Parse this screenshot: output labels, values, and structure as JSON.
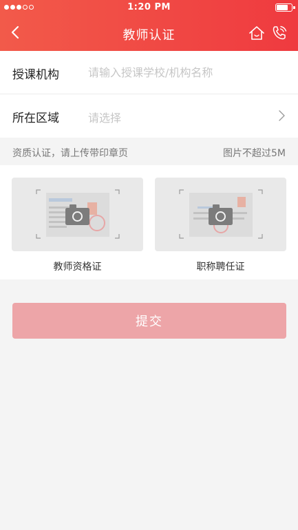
{
  "status_bar": {
    "time": "1:20 PM"
  },
  "nav": {
    "title": "教师认证"
  },
  "form": {
    "institution": {
      "label": "授课机构",
      "placeholder": "请输入授课学校/机构名称"
    },
    "region": {
      "label": "所在区域",
      "placeholder": "请选择"
    }
  },
  "note": {
    "left": "资质认证，请上传带印章页",
    "right": "图片不超过5M"
  },
  "uploads": [
    {
      "caption": "教师资格证"
    },
    {
      "caption": "职称聘任证"
    }
  ],
  "submit_label": "提交",
  "colors": {
    "header_start": "#f25a4a",
    "header_end": "#ef3a3f",
    "submit_disabled": "#eda5a8",
    "background": "#f4f4f4"
  },
  "icons": [
    "back-arrow-icon",
    "home-icon",
    "phone-icon",
    "chevron-right-icon",
    "camera-icon",
    "battery-icon"
  ]
}
